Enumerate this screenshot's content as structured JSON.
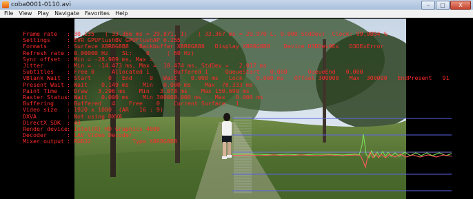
{
  "window": {
    "title": "coba0001-0110.avi",
    "icon": "media-player-icon",
    "controls": {
      "minimize": "–",
      "maximize": "□",
      "close": "X"
    }
  },
  "menu": [
    {
      "label": "File"
    },
    {
      "label": "View"
    },
    {
      "label": "Play"
    },
    {
      "label": "Navigate"
    },
    {
      "label": "Favorites"
    },
    {
      "label": "Help"
    }
  ],
  "stats": [
    {
      "label": "Frame rate",
      "value": "30.135   ( 33.366 ms = 29.871, I)   ( 33.367 ms = 29.970 L, 0.000 StdDev)  Clock: 99.9854 %"
    },
    {
      "label": "Settings",
      "value": "EVR GPUFlushBV GPUFlushAP 0.255"
    },
    {
      "label": "Formats",
      "value": "Surface X8R8G8B8   Backbuffer X8R8G8B8   Display X8R8G8B8    Device D3DDev9Ex   D3DExError"
    },
    {
      "label": "Refresh rate",
      "value": "0.00000 Hz    SL:    0     ( 60 Hz)"
    },
    {
      "label": "Sync offset",
      "value": "Min = -28.989 ms, Max ="
    },
    {
      "label": "Jitter",
      "value": "Min =  -14.473 ms, Max =  18.474 ms, StdDev =   2.017 ms"
    },
    {
      "label": "Subtitles",
      "value": "Free 0     Allocated 1       Buffered 1     QueueStart   0.000      QueueEnd   0.000"
    },
    {
      "label": "VBlank Wait",
      "value": "Start     0   End     0   Wait    0.000 ms   Lock    0.000 ms   Offset 300000   Max  300000   EndPresent   91"
    },
    {
      "label": "Present Wait",
      "value": "Wait    0.149 ms    Min   0.000 ms    Max  78.333 ms"
    },
    {
      "label": "Paint Time",
      "value": "Draw   3.296 ms    Min   3.078 ms    Max 150.690 ms"
    },
    {
      "label": "Raster Status",
      "value": "Wait    0.000 ms    Min 300000.000 ms    Max   0.000 ms"
    },
    {
      "label": "Buffering",
      "value": "Buffered   4    Free    0    Current Surface   1"
    },
    {
      "label": "Video size",
      "value": "1920 x 1080  (AR   16 : 9)"
    },
    {
      "label": "DXVA",
      "value": "Not using DXVA"
    },
    {
      "label": "DirectX SDK",
      "value": "43"
    },
    {
      "label": "Render device",
      "value": "Intel(R) HD Graphics 4000"
    },
    {
      "label": "Decoder",
      "value": "LAV Video Decoder"
    },
    {
      "label": "Mixer output",
      "value": "RGB32            Type X8R8G8B8"
    }
  ],
  "colors": {
    "stats_text": "#ff2b2b",
    "graph_reference_lines": "#5b63e8",
    "graph_jitter": "#ff5a5a",
    "graph_sync": "#7be05a"
  }
}
